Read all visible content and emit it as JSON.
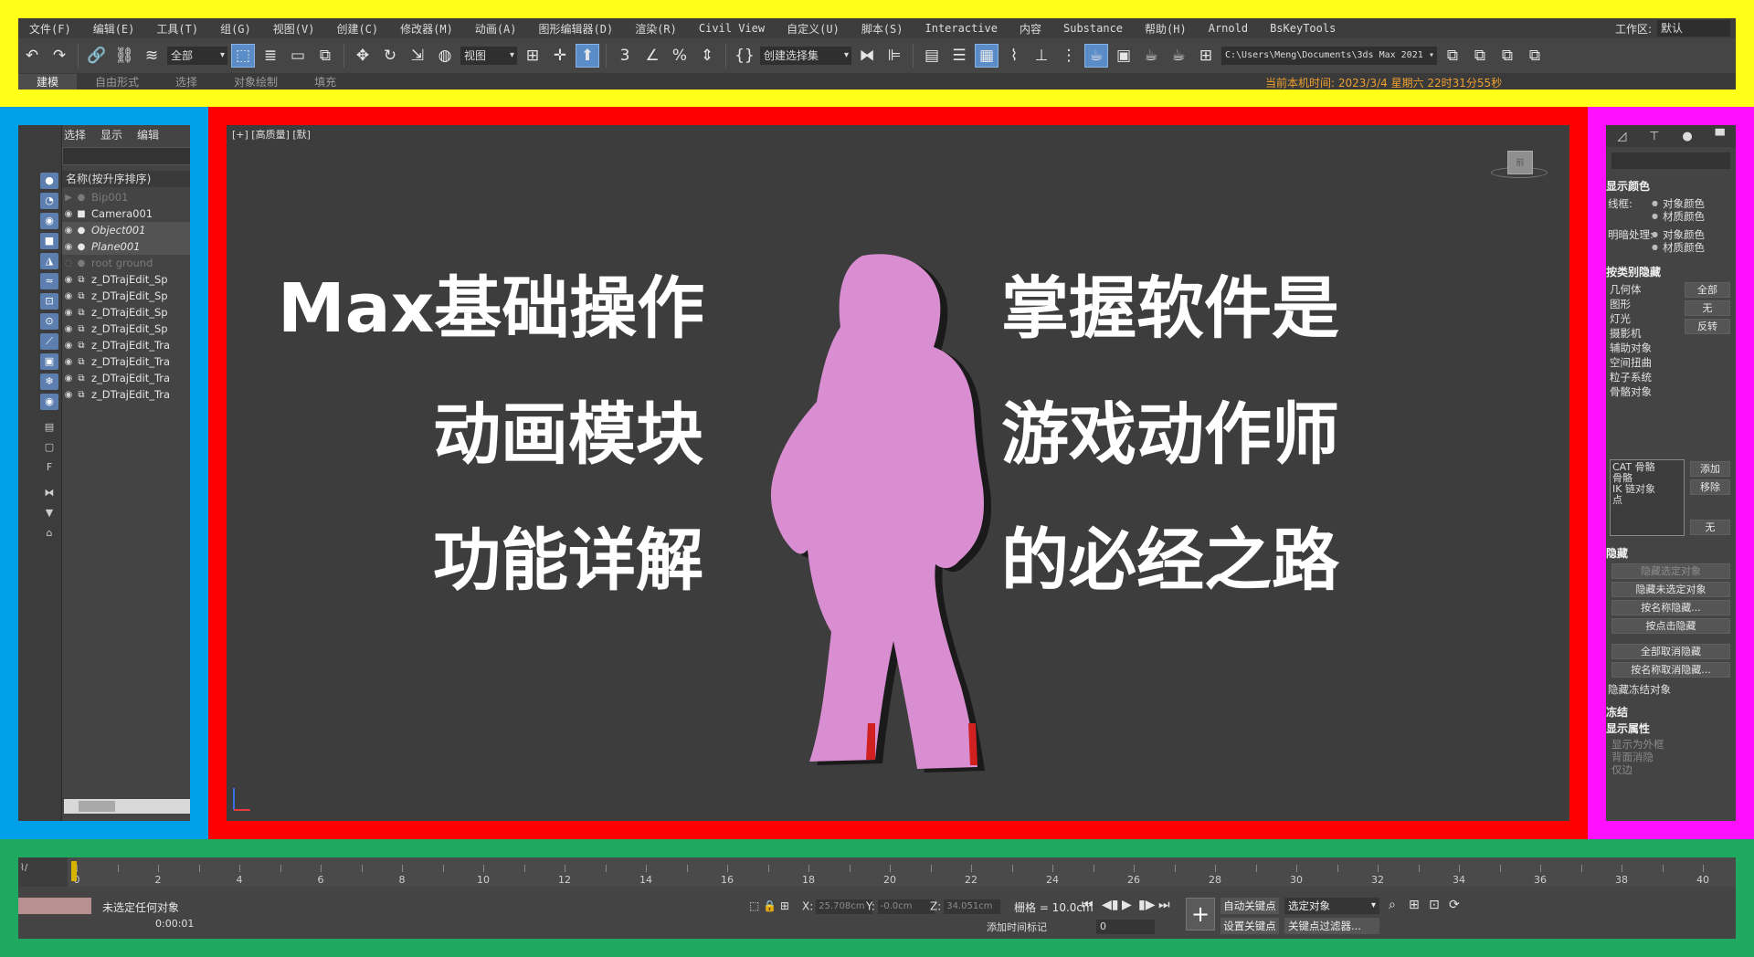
{
  "frame_colors": {
    "top": "#ffff18",
    "left": "#00a0e8",
    "center": "#ff0000",
    "right": "#ff10ff",
    "bottom": "#1ea860"
  },
  "menubar": {
    "items": [
      "文件(F)",
      "编辑(E)",
      "工具(T)",
      "组(G)",
      "视图(V)",
      "创建(C)",
      "修改器(M)",
      "动画(A)",
      "图形编辑器(D)",
      "渲染(R)",
      "Civil View",
      "自定义(U)",
      "脚本(S)",
      "Interactive",
      "内容",
      "Substance",
      "帮助(H)",
      "Arnold",
      "BsKeyTools"
    ],
    "workspace_label": "工作区:",
    "workspace_value": "默认"
  },
  "toolbar": {
    "selection_filter": "全部",
    "ref_coord": "视图",
    "named_selection": "创建选择集",
    "project_path": "C:\\Users\\Meng\\Documents\\3ds Max 2021",
    "icons": [
      "undo-icon",
      "redo-icon",
      "link-icon",
      "unlink-icon",
      "bind-spacewarp-icon"
    ]
  },
  "ribbon": {
    "tabs": [
      "建模",
      "自由形式",
      "选择",
      "对象绘制",
      "填充"
    ],
    "clock": "当前本机时间: 2023/3/4 星期六 22时31分55秒"
  },
  "scene_explorer": {
    "tabs": [
      "选择",
      "显示",
      "编辑"
    ],
    "header": "名称(按升序排序)",
    "items": [
      {
        "name": "Bip001",
        "state": "hidden"
      },
      {
        "name": "Camera001",
        "state": "normal"
      },
      {
        "name": "Object001",
        "state": "italic"
      },
      {
        "name": "Plane001",
        "state": "italic"
      },
      {
        "name": "root ground",
        "state": "hidden"
      },
      {
        "name": "z_DTrajEdit_Sp",
        "state": "normal"
      },
      {
        "name": "z_DTrajEdit_Sp",
        "state": "normal"
      },
      {
        "name": "z_DTrajEdit_Sp",
        "state": "normal"
      },
      {
        "name": "z_DTrajEdit_Sp",
        "state": "normal"
      },
      {
        "name": "z_DTrajEdit_Tra",
        "state": "normal"
      },
      {
        "name": "z_DTrajEdit_Tra",
        "state": "normal"
      },
      {
        "name": "z_DTrajEdit_Tra",
        "state": "normal"
      },
      {
        "name": "z_DTrajEdit_Tra",
        "state": "normal"
      }
    ]
  },
  "viewport": {
    "label": "[+] [高质量] [默]",
    "viewcube_label": "前",
    "overlay_left": [
      "Max基础操作",
      "动画模块",
      "功能详解"
    ],
    "overlay_right": [
      "掌握软件是",
      "游戏动作师",
      "的必经之路"
    ],
    "figure_color": "#d88ed0"
  },
  "command_panel": {
    "display_color_title": "显示颜色",
    "wire_label": "线框:",
    "shaded_label": "明暗处理:",
    "object_color": "对象颜色",
    "material_color": "材质颜色",
    "hide_by_category_title": "按类别隐藏",
    "categories": [
      "几何体",
      "图形",
      "灯光",
      "摄影机",
      "辅助对象",
      "空间扭曲",
      "粒子系统",
      "骨骼对象"
    ],
    "category_buttons": [
      "全部",
      "无",
      "反转"
    ],
    "list_items": [
      "CAT 骨骼",
      "骨骼",
      "IK 链对象",
      "点"
    ],
    "list_buttons": [
      "添加",
      "移除",
      "无"
    ],
    "hide_title": "隐藏",
    "hide_buttons": [
      "隐藏选定对象",
      "隐藏未选定对象",
      "按名称隐藏...",
      "按点击隐藏",
      "全部取消隐藏",
      "按名称取消隐藏...",
      "隐藏冻结对象"
    ],
    "freeze_title": "冻结",
    "display_props_title": "显示属性",
    "display_props": [
      "显示为外框",
      "背面消隐",
      "仅边"
    ]
  },
  "timeline": {
    "frame_labels": [
      0,
      2,
      4,
      6,
      8,
      10,
      12,
      14,
      16,
      18,
      20,
      22,
      24,
      26,
      28,
      30,
      32,
      34,
      36,
      38,
      40
    ],
    "current_frame": 0
  },
  "status": {
    "message": "未选定任何对象",
    "time": "0:00:01",
    "x_label": "X:",
    "x_value": "25.708cm",
    "y_label": "Y:",
    "y_value": "-0.0cm",
    "z_label": "Z:",
    "z_value": "34.051cm",
    "grid": "栅格 = 10.0cm",
    "add_time_tag": "添加时间标记",
    "auto_key": "自动关键点",
    "set_key": "设置关键点",
    "selected_drop": "选定对象",
    "key_filters": "关键点过滤器...",
    "frame_spinner": "0"
  }
}
